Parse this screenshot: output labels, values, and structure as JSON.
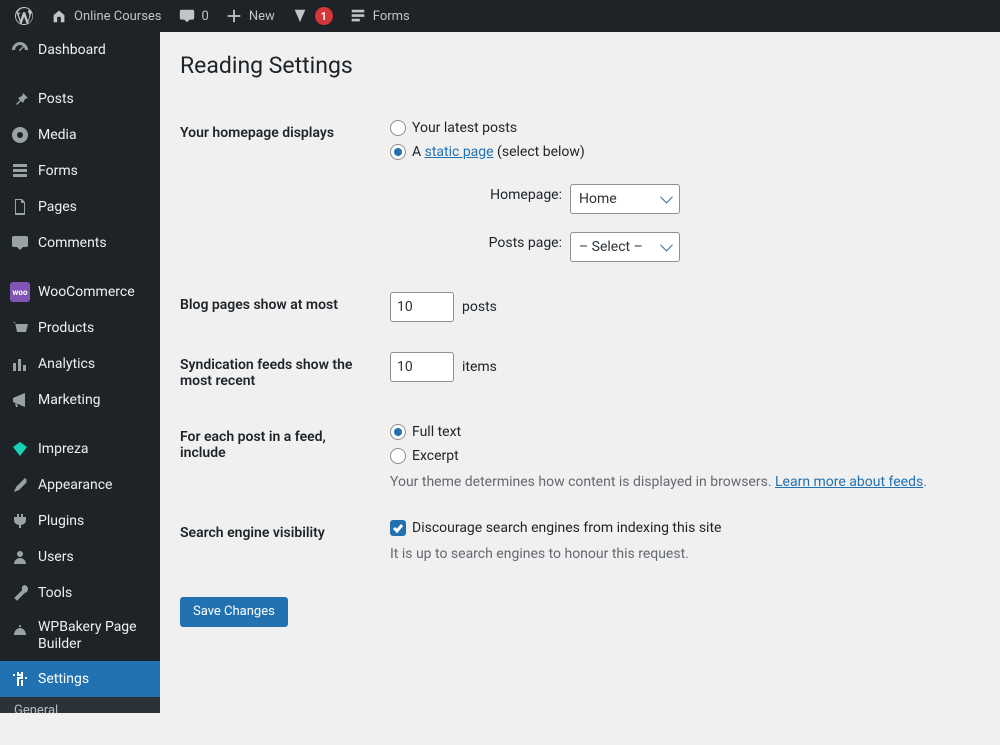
{
  "adminbar": {
    "site_name": "Online Courses",
    "comments_count": "0",
    "new_label": "New",
    "yoast_count": "1",
    "forms_label": "Forms"
  },
  "sidebar": {
    "dashboard": "Dashboard",
    "posts": "Posts",
    "media": "Media",
    "forms": "Forms",
    "pages": "Pages",
    "comments": "Comments",
    "woocommerce": "WooCommerce",
    "products": "Products",
    "analytics": "Analytics",
    "marketing": "Marketing",
    "impreza": "Impreza",
    "appearance": "Appearance",
    "plugins": "Plugins",
    "users": "Users",
    "tools": "Tools",
    "wpbakery": "WPBakery Page Builder",
    "settings": "Settings",
    "submenu": {
      "general": "General"
    },
    "colors": {
      "impreza": "#17d1b8"
    }
  },
  "page": {
    "title": "Reading Settings",
    "homepage": {
      "label": "Your homepage displays",
      "opt_latest": "Your latest posts",
      "opt_static_prefix": "A ",
      "opt_static_link": "static page",
      "opt_static_suffix": " (select below)",
      "selected": "static",
      "homepage_label": "Homepage:",
      "homepage_value": "Home",
      "postspage_label": "Posts page:",
      "postspage_value": "– Select –"
    },
    "blog_pages": {
      "label": "Blog pages show at most",
      "value": "10",
      "unit": "posts"
    },
    "syndication": {
      "label": "Syndication feeds show the most recent",
      "value": "10",
      "unit": "items"
    },
    "feed_content": {
      "label": "For each post in a feed, include",
      "opt_full": "Full text",
      "opt_excerpt": "Excerpt",
      "desc_prefix": "Your theme determines how content is displayed in browsers. ",
      "desc_link": "Learn more about feeds",
      "desc_suffix": "."
    },
    "seo": {
      "label": "Search engine visibility",
      "checkbox": "Discourage search engines from indexing this site",
      "desc": "It is up to search engines to honour this request."
    },
    "save": "Save Changes"
  }
}
